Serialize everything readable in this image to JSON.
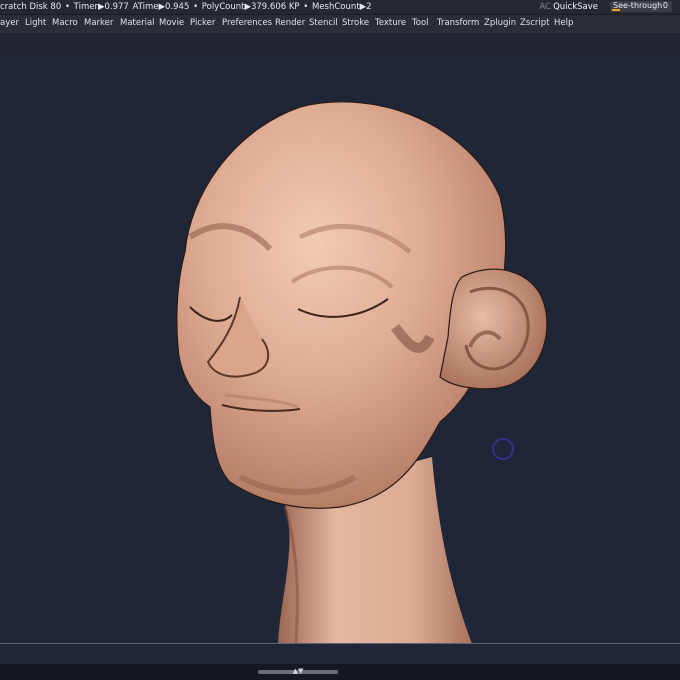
{
  "status": {
    "scratch_disk": "cratch Disk 80",
    "timer": "Timer▶0.977",
    "atime": "ATime▶0.945",
    "polycount": "PolyCount▶379.606 KP",
    "meshcount": "MeshCount▶2",
    "ac": "AC",
    "quicksave": "QuickSave",
    "see_through_label": "See-through",
    "see_through_value": "0"
  },
  "menu": {
    "items": [
      "ayer",
      "Light",
      "Macro",
      "Marker",
      "Material",
      "Movie",
      "Picker",
      "Preferences",
      "Render",
      "Stencil",
      "Stroke",
      "Texture",
      "Tool",
      "Transform",
      "Zplugin",
      "Zscript",
      "Help"
    ]
  },
  "colors": {
    "canvas_bg": "#1f2638",
    "skin": "#d9a48c",
    "accent": "#f4a424"
  },
  "icons": {
    "scroll": "up-down-arrow-icon",
    "cursor": "brush-circle-icon"
  }
}
